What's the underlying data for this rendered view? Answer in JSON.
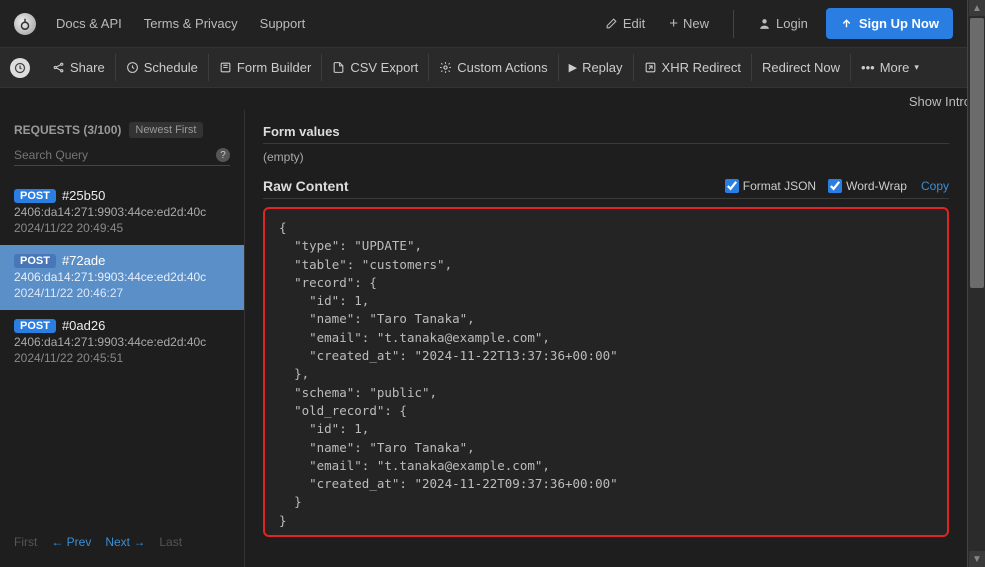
{
  "topnav": {
    "links": [
      "Docs & API",
      "Terms & Privacy",
      "Support"
    ],
    "edit": "Edit",
    "new": "New",
    "login": "Login",
    "signup": "Sign Up Now"
  },
  "toolbar": {
    "share": "Share",
    "schedule": "Schedule",
    "form_builder": "Form Builder",
    "csv_export": "CSV Export",
    "custom_actions": "Custom Actions",
    "replay": "Replay",
    "xhr_redirect": "XHR Redirect",
    "redirect_now": "Redirect Now",
    "more": "More",
    "show_intro": "Show Intro"
  },
  "sidebar": {
    "header": "REQUESTS (3/100)",
    "newest": "Newest First",
    "search_placeholder": "Search Query",
    "requests": [
      {
        "method": "POST",
        "id": "#25b50",
        "ip": "2406:da14:271:9903:44ce:ed2d:40c",
        "time": "2024/11/22 20:49:45"
      },
      {
        "method": "POST",
        "id": "#72ade",
        "ip": "2406:da14:271:9903:44ce:ed2d:40c",
        "time": "2024/11/22 20:46:27"
      },
      {
        "method": "POST",
        "id": "#0ad26",
        "ip": "2406:da14:271:9903:44ce:ed2d:40c",
        "time": "2024/11/22 20:45:51"
      }
    ],
    "pager": {
      "first": "First",
      "prev": "←  Prev",
      "next": "Next →",
      "last": "Last"
    }
  },
  "detail": {
    "form_values_title": "Form values",
    "form_values_empty": "(empty)",
    "raw_title": "Raw Content",
    "format_json": "Format JSON",
    "word_wrap": "Word-Wrap",
    "copy": "Copy",
    "raw_body": "{\n  \"type\": \"UPDATE\",\n  \"table\": \"customers\",\n  \"record\": {\n    \"id\": 1,\n    \"name\": \"Taro Tanaka\",\n    \"email\": \"t.tanaka@example.com\",\n    \"created_at\": \"2024-11-22T13:37:36+00:00\"\n  },\n  \"schema\": \"public\",\n  \"old_record\": {\n    \"id\": 1,\n    \"name\": \"Taro Tanaka\",\n    \"email\": \"t.tanaka@example.com\",\n    \"created_at\": \"2024-11-22T09:37:36+00:00\"\n  }\n}"
  }
}
